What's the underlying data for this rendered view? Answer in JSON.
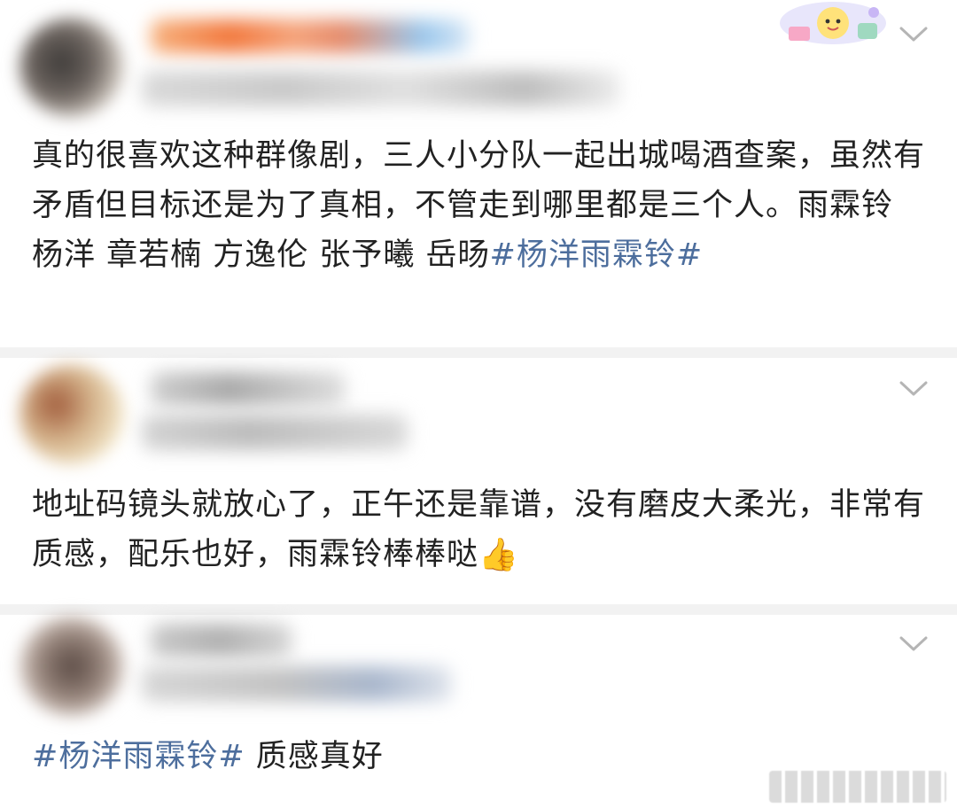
{
  "comments": [
    {
      "text_before_tag": "真的很喜欢这种群像剧，三人小分队一起出城喝酒查案，虽然有矛盾但目标还是为了真相，不管走到哪里都是三个人。雨霖铃 杨洋 章若楠 方逸伦 张予曦 岳旸",
      "tag": "#杨洋雨霖铃#",
      "text_after_tag": ""
    },
    {
      "text_before_tag": "地址码镜头就放心了，正午还是靠谱，没有磨皮大柔光，非常有质感，配乐也好，雨霖铃棒棒哒",
      "tag": "",
      "text_after_tag": "",
      "emoji": "thumbs-up"
    },
    {
      "text_before_tag": "",
      "tag": "#杨洋雨霖铃#",
      "text_after_tag": " 质感真好"
    }
  ],
  "colors": {
    "hashtag": "#4d6e9d",
    "body_text": "#222222",
    "divider": "#f2f2f2",
    "chevron": "#b5b5b5"
  }
}
